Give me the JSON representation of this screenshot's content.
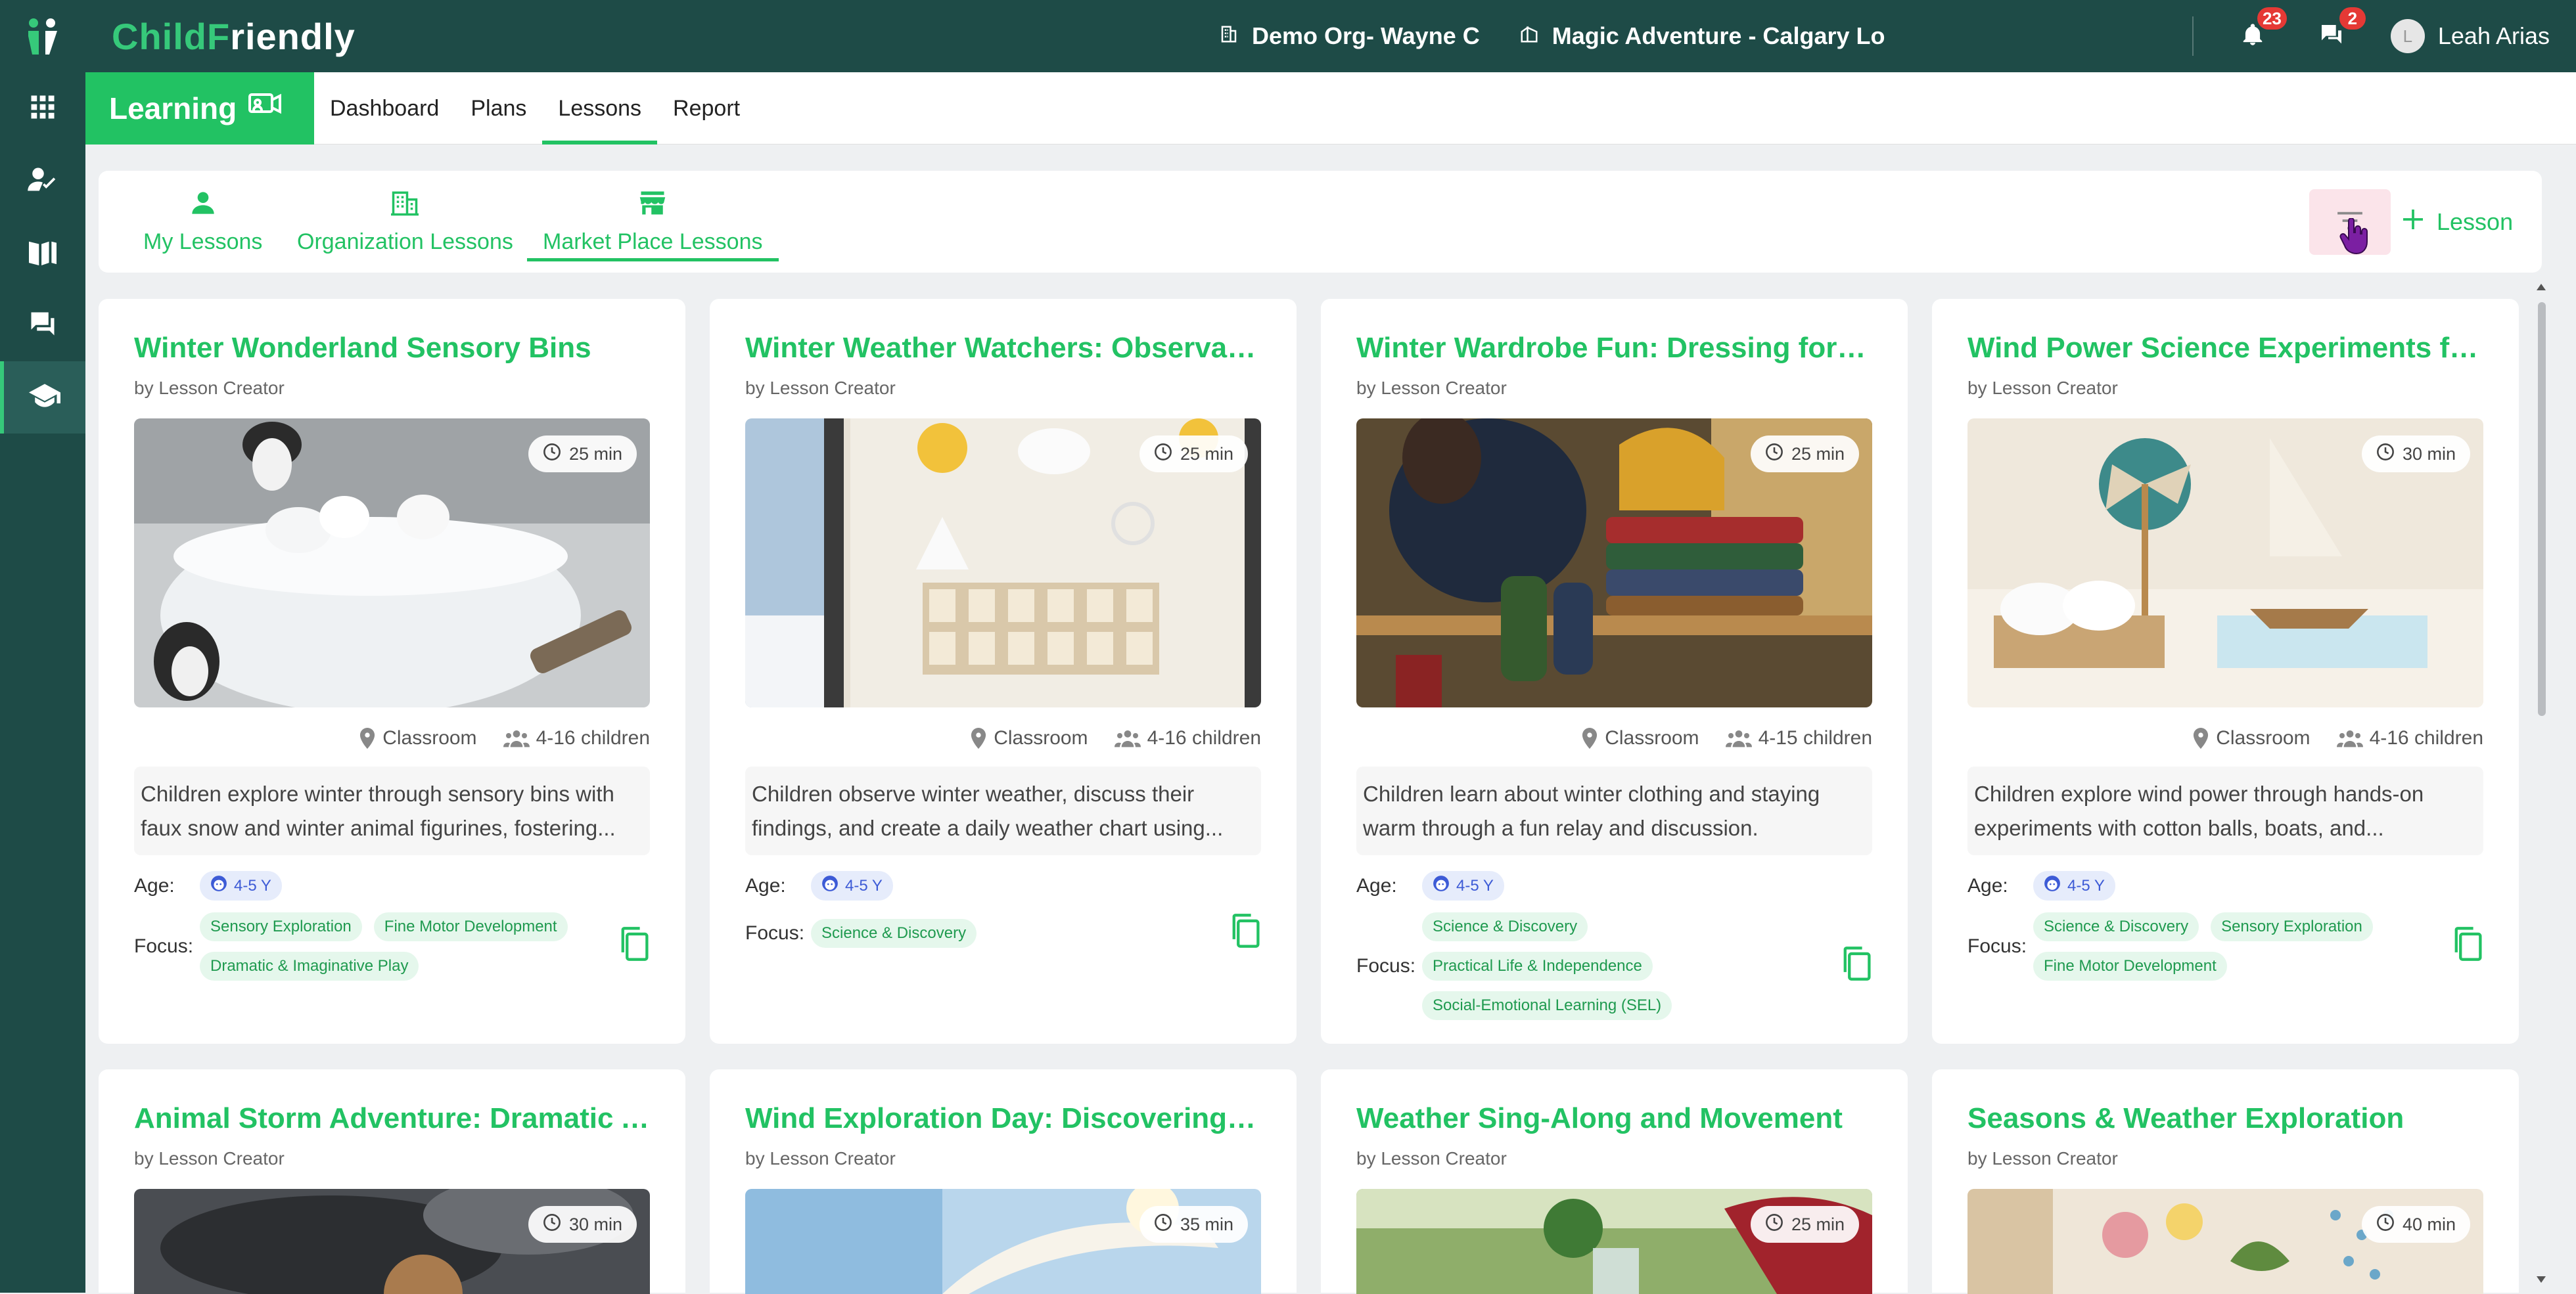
{
  "brand": {
    "name_part1": "ChildF",
    "name_part2": "riendly"
  },
  "header": {
    "org": "Demo Org- Wayne C",
    "location": "Magic Adventure - Calgary Lo",
    "notifications_count": "23",
    "messages_count": "2",
    "avatar_initial": "L",
    "user_name": "Leah Arias"
  },
  "sidebar": {
    "items": [
      "apps-icon",
      "person-check-icon",
      "book-icon",
      "chat-icon",
      "school-icon"
    ]
  },
  "nav": {
    "module": "Learning",
    "links": [
      {
        "label": "Dashboard"
      },
      {
        "label": "Plans"
      },
      {
        "label": "Lessons"
      },
      {
        "label": "Report"
      }
    ]
  },
  "subtabs": [
    {
      "label": "My Lessons",
      "icon": "person-icon"
    },
    {
      "label": "Organization Lessons",
      "icon": "building-icon"
    },
    {
      "label": "Market Place Lessons",
      "icon": "store-icon"
    }
  ],
  "actions": {
    "add_lesson": "Lesson"
  },
  "labels": {
    "age": "Age:",
    "focus": "Focus:"
  },
  "cards": [
    {
      "title": "Winter Wonderland Sensory Bins",
      "author": "by Lesson Creator",
      "duration": "25 min",
      "location": "Classroom",
      "children": "4-16 children",
      "description": "Children explore winter through sensory bins with faux snow and winter animal figurines, fostering...",
      "age": "4-5 Y",
      "focus": [
        "Sensory Exploration",
        "Fine Motor Development",
        "Dramatic & Imaginative Play"
      ]
    },
    {
      "title": "Winter Weather Watchers: Observati...",
      "author": "by Lesson Creator",
      "duration": "25 min",
      "location": "Classroom",
      "children": "4-16 children",
      "description": "Children observe winter weather, discuss their findings, and create a daily weather chart using...",
      "age": "4-5 Y",
      "focus": [
        "Science & Discovery"
      ]
    },
    {
      "title": "Winter Wardrobe Fun: Dressing for C...",
      "author": "by Lesson Creator",
      "duration": "25 min",
      "location": "Classroom",
      "children": "4-15 children",
      "description": "Children learn about winter clothing and staying warm through a fun relay and discussion.",
      "age": "4-5 Y",
      "focus": [
        "Science & Discovery",
        "Practical Life & Independence",
        "Social-Emotional Learning (SEL)"
      ]
    },
    {
      "title": "Wind Power Science Experiments for...",
      "author": "by Lesson Creator",
      "duration": "30 min",
      "location": "Classroom",
      "children": "4-16 children",
      "description": "Children explore wind power through hands-on experiments with cotton balls, boats, and...",
      "age": "4-5 Y",
      "focus": [
        "Science & Discovery",
        "Sensory Exploration",
        "Fine Motor Development"
      ]
    },
    {
      "title": "Animal Storm Adventure: Dramatic A...",
      "author": "by Lesson Creator",
      "duration": "30 min"
    },
    {
      "title": "Wind Exploration Day: Discovering H...",
      "author": "by Lesson Creator",
      "duration": "35 min"
    },
    {
      "title": "Weather Sing-Along and Movement",
      "author": "by Lesson Creator",
      "duration": "25 min"
    },
    {
      "title": "Seasons & Weather Exploration",
      "author": "by Lesson Creator",
      "duration": "40 min"
    }
  ],
  "colors": {
    "primary": "#22c263",
    "header_bg": "#1e4b47",
    "focus_tag_bg": "#e5f7ec",
    "age_chip_bg": "#e6ecfb"
  }
}
